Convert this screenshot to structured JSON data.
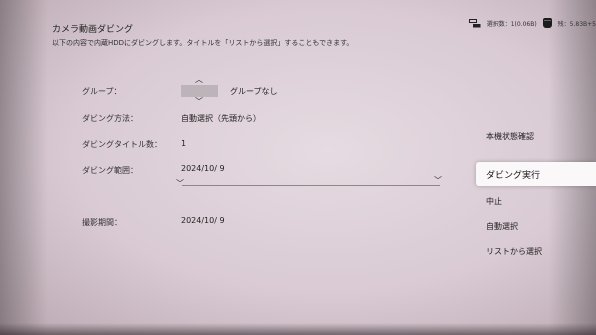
{
  "header": {
    "title": "カメラ動画ダビング",
    "description": "以下の内容で内蔵HDDにダビングします。タイトルを「リストから選択」することもできます。"
  },
  "status": {
    "selection_count": "選択数：1(0.06B)",
    "hdd_remaining": "残：5.83B+5"
  },
  "form": {
    "group_label": "グループ：",
    "group_value": "グループなし",
    "method_label": "ダビング方法：",
    "method_value": "自動選択（先頭から）",
    "count_label": "ダビングタイトル数：",
    "count_value": "1",
    "range_label": "ダビング範囲：",
    "range_value": "2024/10/ 9",
    "period_label": "撮影期間：",
    "period_value": "2024/10/ 9"
  },
  "menu": {
    "device_status": "本機状態確認",
    "start_dubbing": "ダビング実行",
    "cancel": "中止",
    "auto_select": "自動選択",
    "select_from_list": "リストから選択"
  }
}
